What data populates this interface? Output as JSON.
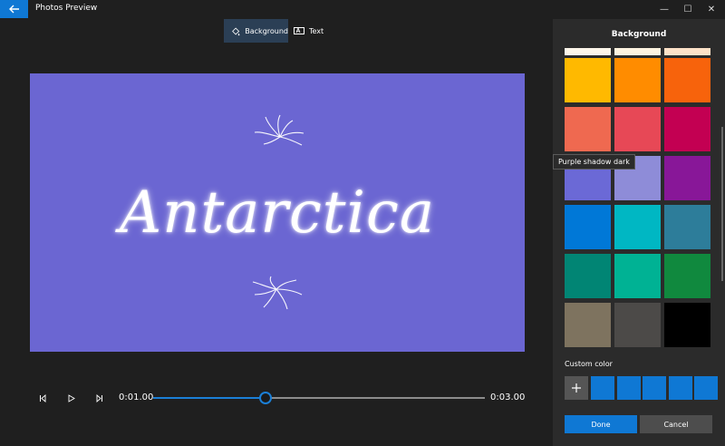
{
  "app": {
    "title": "Photos Preview"
  },
  "window_controls": {
    "minimize": "—",
    "maximize": "☐",
    "close": "✕"
  },
  "toolbar": {
    "background_label": "Background",
    "text_label": "Text"
  },
  "canvas": {
    "title_text": "Antarctica",
    "background_color": "#6b66d2"
  },
  "playback": {
    "current_time": "0:01.00",
    "total_time": "0:03.00",
    "progress": 0.34
  },
  "panel": {
    "title": "Background",
    "tooltip": "Purple shadow dark",
    "custom_color_label": "Custom color",
    "done_label": "Done",
    "cancel_label": "Cancel",
    "swatches": [
      "#ffb900",
      "#ff8c00",
      "#f7630c",
      "#ef6950",
      "#e74856",
      "#c30052",
      "#6b69d6",
      "#8e8cd8",
      "#881798",
      "#0078d7",
      "#00b7c3",
      "#2d7d9a",
      "#018574",
      "#00b294",
      "#10893e",
      "#7e735f",
      "#4c4a48",
      "#000000"
    ],
    "top_strip_colors": [
      "#fdf6ea",
      "#fdf3e0",
      "#fde2c8"
    ],
    "custom_swatch_color": "#0f78d4"
  }
}
